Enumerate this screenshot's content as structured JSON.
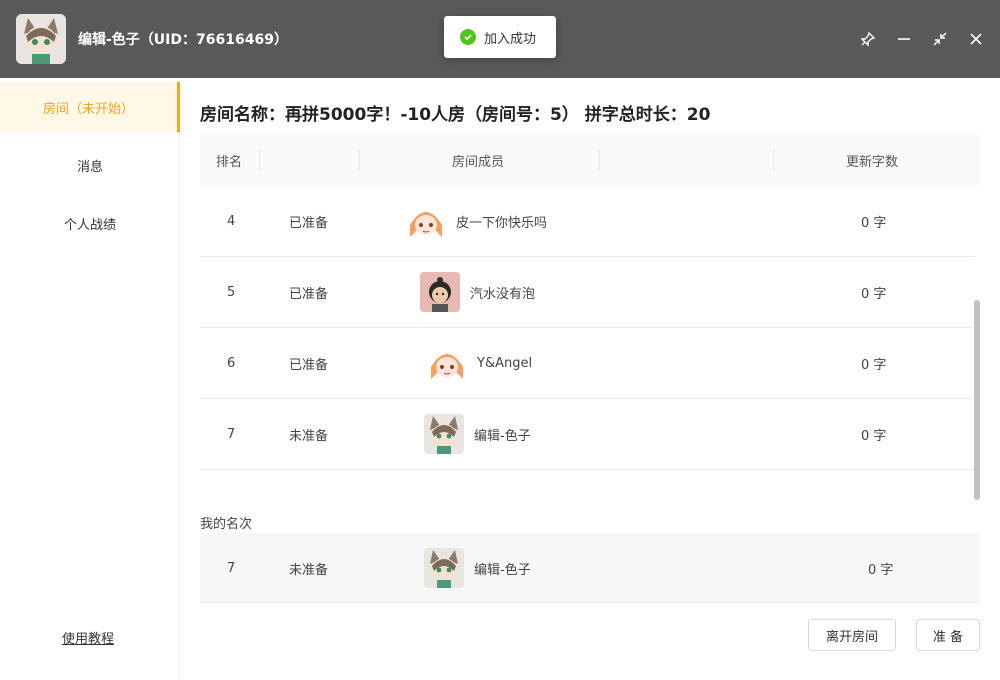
{
  "window": {
    "title": "编辑-色子（UID：76616469）",
    "controls": [
      "pin-icon",
      "minimize-icon",
      "restore-icon",
      "close-icon"
    ]
  },
  "toast": {
    "text": "加入成功",
    "icon": "check-circle-icon",
    "color": "#52c41a"
  },
  "sidebar": {
    "items": [
      {
        "label": "房间（未开始）",
        "active": true
      },
      {
        "label": "消息",
        "active": false
      },
      {
        "label": "个人战绩",
        "active": false
      }
    ],
    "tutorial": "使用教程",
    "accent": "#f5a623"
  },
  "room": {
    "title": "房间名称：再拼5000字！-10人房（房间号：5） 拼字总时长：20"
  },
  "table": {
    "headers": {
      "rank": "排名",
      "members": "房间成员",
      "words": "更新字数"
    },
    "rows": [
      {
        "rank": "4",
        "status": "已准备",
        "name": "皮一下你快乐吗",
        "words": "0 字",
        "avatar": "anime-girl-avatar"
      },
      {
        "rank": "5",
        "status": "已准备",
        "name": "汽水没有泡",
        "words": "0 字",
        "avatar": "child-photo-avatar"
      },
      {
        "rank": "6",
        "status": "已准备",
        "name": "Y&Angel",
        "words": "0 字",
        "avatar": "anime-girl-avatar"
      },
      {
        "rank": "7",
        "status": "未准备",
        "name": "编辑-色子",
        "words": "0 字",
        "avatar": "cat-boy-avatar"
      }
    ]
  },
  "my_rank": {
    "label": "我的名次",
    "rank": "7",
    "status": "未准备",
    "name": "编辑-色子",
    "words": "0 字"
  },
  "actions": {
    "leave": "离开房间",
    "ready": "准 备"
  }
}
